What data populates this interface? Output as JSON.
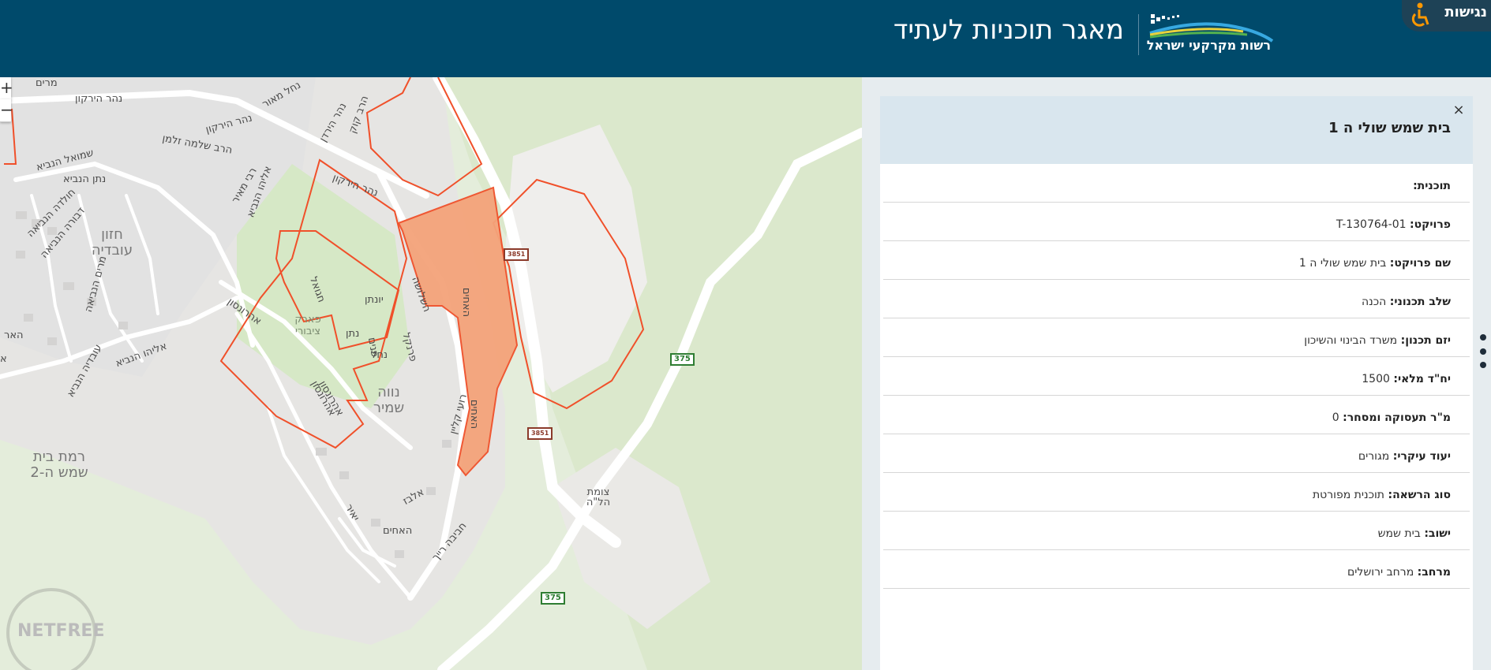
{
  "header": {
    "app_title": "מאגר תוכניות לעתיד",
    "logo_text": "רשות מקרקעי ישראל",
    "accessibility_label": "נגישות"
  },
  "map": {
    "zoom_in": "+",
    "zoom_out": "−",
    "street_labels": [
      "נהר הירקון",
      "נהר הירקון",
      "נהר הירקון",
      "נחל מאור",
      "נהר הירדן",
      "הרב קוק",
      "הרב שלמה זלמן",
      "שמואל הנביא",
      "נתן הנביא",
      "חולדה הנביאה",
      "דבורה הנביאה",
      "מרים הנביאה",
      "אליהו הנביא",
      "אליהו הנביא",
      "אהרונסון",
      "אהרונסון",
      "עובדיה הנביא",
      "רבי מאיר",
      "חגואל",
      "יונתן",
      "השלושה",
      "האחים",
      "האחים",
      "פרנקל",
      "רועי קליין",
      "אלבז",
      "האחים",
      "חביבה רייך",
      "יאיר",
      "פנים",
      "מרים",
      "נחל",
      "נתן",
      "א",
      "האר",
      "אהרונסון"
    ],
    "neighborhoods": {
      "hazon_ovadia": "חזון עובדיה",
      "park": "פארק ציבורי",
      "neve_shamir": "נווה שמיר",
      "ramat_bs": "רמת בית שמש ה-2",
      "junction": "צומת הל\"ה"
    },
    "road_shields": [
      "375",
      "375",
      "3851",
      "3851"
    ],
    "watermark": "NETFREE"
  },
  "panel": {
    "title": "בית שמש שולי ה 1",
    "close": "×",
    "rows": [
      {
        "label": "תוכנית:",
        "value": ""
      },
      {
        "label": "פרויקט:",
        "value": "T-130764-01"
      },
      {
        "label": "שם פרויקט:",
        "value": "בית שמש שולי ה 1"
      },
      {
        "label": "שלב תכנוני:",
        "value": "הכנה"
      },
      {
        "label": "יזם תכנון:",
        "value": "משרד הבינוי והשיכון"
      },
      {
        "label": "יח\"ד מלאי:",
        "value": "1500"
      },
      {
        "label": "מ\"ר תעסוקה ומסחר:",
        "value": "0"
      },
      {
        "label": "יעוד עיקרי:",
        "value": "מגורים"
      },
      {
        "label": "סוג הרשאה:",
        "value": "תוכנית מפורטת"
      },
      {
        "label": "ישוב:",
        "value": "בית שמש"
      },
      {
        "label": "מרחב:",
        "value": "מרחב ירושלים"
      }
    ]
  },
  "colors": {
    "header_bg": "#004a6b",
    "panel_head_bg": "#d9e6ee",
    "plan_outline": "#f0502a",
    "plan_fill": "#f4a37a"
  }
}
